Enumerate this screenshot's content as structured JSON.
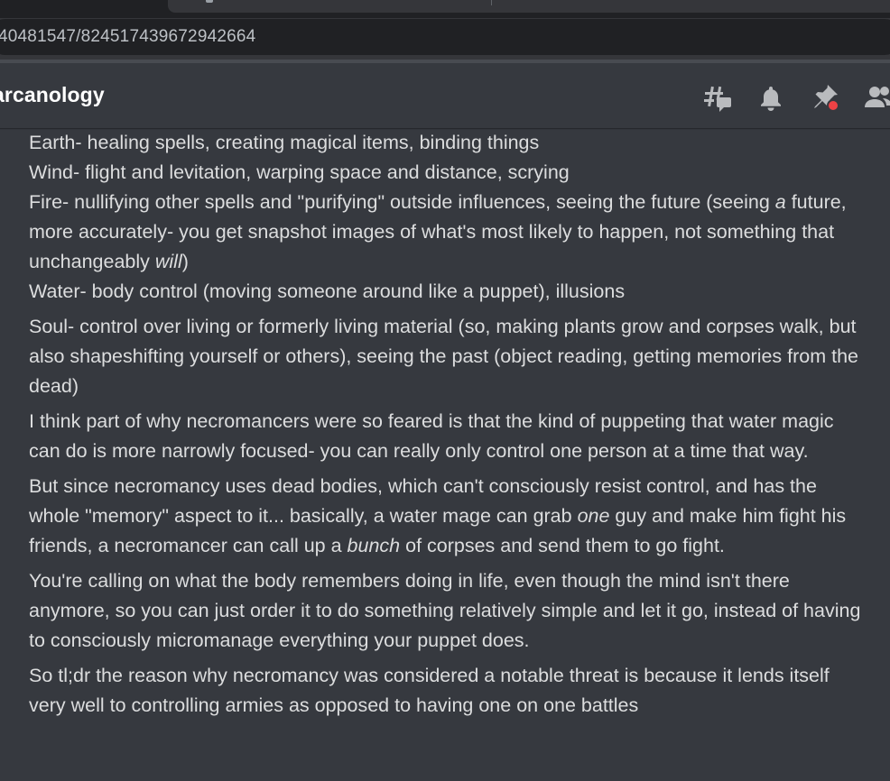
{
  "browser": {
    "url": "40481547/824517439672942664"
  },
  "channel": {
    "name": "arcanology",
    "icons": [
      "threads-icon",
      "bell-icon",
      "pin-icon",
      "members-icon"
    ],
    "notification_dot_color": "#ed4245"
  },
  "messages": [
    {
      "lines": [
        {
          "parts": [
            "Earth- healing spells, creating magical items, binding things"
          ]
        },
        {
          "parts": [
            "Wind- flight and levitation, warping space and distance, scrying"
          ]
        },
        {
          "parts": [
            "Fire- nullifying other spells and \"purifying\" outside influences, seeing the future (seeing ",
            "a",
            " future, more accurately- you get snapshot images of what's most likely to happen, not something that unchangeably ",
            "will",
            ")"
          ],
          "italic": [
            1,
            3
          ]
        },
        {
          "parts": [
            "Water- body control (moving someone around like a puppet), illusions"
          ]
        }
      ]
    },
    {
      "lines": [
        {
          "parts": [
            "Soul- control over living or formerly living material (so, making plants grow and corpses walk, but also shapeshifting yourself or others), seeing the past (object reading, getting memories from the dead)"
          ]
        }
      ]
    },
    {
      "lines": [
        {
          "parts": [
            "I think part of why necromancers were so feared is that the kind of puppeting that water magic can do is more narrowly focused- you can really only control one person at a time that way."
          ]
        }
      ]
    },
    {
      "lines": [
        {
          "parts": [
            "But since necromancy uses dead bodies, which can't consciously resist control, and has the whole \"memory\" aspect to it... basically, a water mage can grab ",
            "one",
            " guy and make him fight his friends, a necromancer can call up a ",
            "bunch",
            " of corpses and send them to go fight."
          ],
          "italic": [
            1,
            3
          ]
        }
      ]
    },
    {
      "lines": [
        {
          "parts": [
            "You're calling on what the body remembers doing in life, even though the mind isn't there anymore, so you can just order it to do something relatively simple and let it go, instead of having to consciously micromanage everything your puppet does."
          ]
        }
      ]
    },
    {
      "lines": [
        {
          "parts": [
            "So tl;dr the reason why necromancy was considered a notable threat is because it lends itself very well to controlling armies as opposed to having one on one battles"
          ]
        }
      ]
    }
  ]
}
